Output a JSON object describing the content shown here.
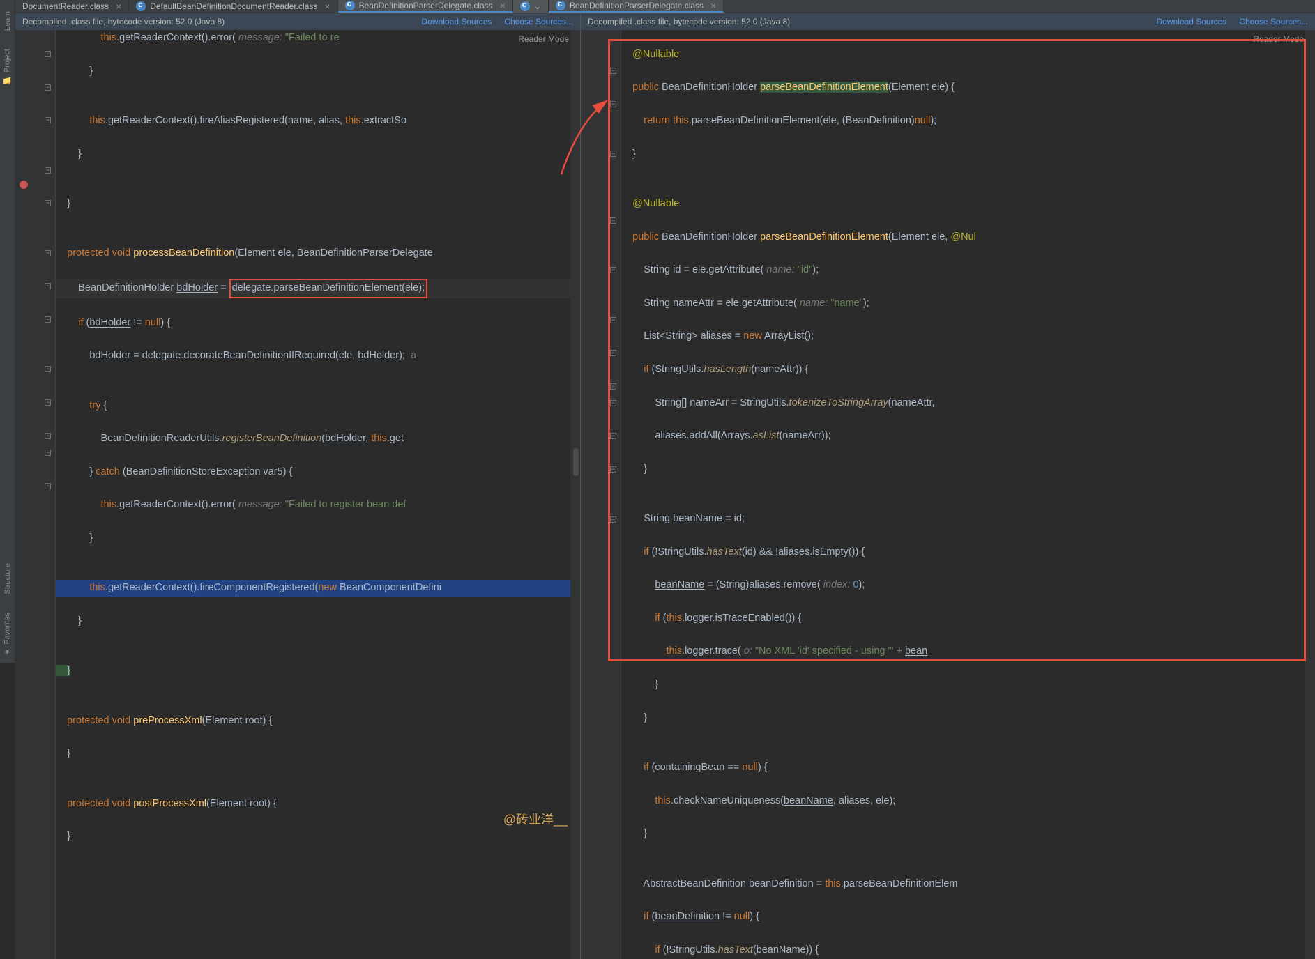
{
  "sidebar": {
    "learn": "Learn",
    "project": "Project",
    "structure": "Structure",
    "favorites": "Favorites"
  },
  "tabs_left": [
    {
      "label": "DocumentReader.class",
      "active": false,
      "partial": true
    },
    {
      "label": "DefaultBeanDefinitionDocumentReader.class",
      "active": false
    },
    {
      "label": "BeanDefinitionParserDelegate.class",
      "active": true
    }
  ],
  "tabs_right": [
    {
      "label": "BeanDefinitionParserDelegate.class",
      "active": true
    }
  ],
  "info_left": {
    "text": "Decompiled .class file, bytecode version: 52.0 (Java 8)",
    "download": "Download Sources",
    "choose": "Choose Sources..."
  },
  "info_right": {
    "text": "Decompiled .class file, bytecode version: 52.0 (Java 8)",
    "download": "Download Sources",
    "choose": "Choose Sources..."
  },
  "reader_mode": "Reader Mode",
  "watermark": "@砖业洋__",
  "left_code": {
    "l1a": "                ",
    "l1b": "this",
    "l1c": ".getReaderContext().error( ",
    "l1p": "message:",
    "l1d": " \"Failed to re",
    "l2": "            }",
    "l3": "",
    "l4a": "            ",
    "l4b": "this",
    "l4c": ".getReaderContext().fireAliasRegistered(name, alias, ",
    "l4d": "this",
    "l4e": ".extractSo",
    "l5": "        }",
    "l6": "",
    "l7": "    }",
    "l8": "",
    "l9a": "    ",
    "l9k": "protected void ",
    "l9m": "processBeanDefinition",
    "l9c": "(Element ele, BeanDefinitionParserDelegate",
    "l10a": "        BeanDefinitionHolder ",
    "l10u": "bdHolder",
    "l10b": " = ",
    "l10box": "delegate.parseBeanDefinitionElement(ele);",
    "l11a": "        ",
    "l11k": "if ",
    "l11b": "(",
    "l11u": "bdHolder",
    "l11c": " != ",
    "l11n": "null",
    "l11d": ") {",
    "l12a": "            ",
    "l12u": "bdHolder",
    "l12b": " = delegate.decorateBeanDefinitionIfRequired(ele, ",
    "l12u2": "bdHolder",
    "l12c": ");  ",
    "l12cm": "a",
    "l13": "",
    "l14a": "            ",
    "l14k": "try ",
    "l14b": "{",
    "l15a": "                BeanDefinitionReaderUtils.",
    "l15m": "registerBeanDefinition",
    "l15b": "(",
    "l15u": "bdHolder",
    "l15c": ", ",
    "l15d": "this",
    "l15e": ".get",
    "l16a": "            } ",
    "l16k": "catch ",
    "l16b": "(BeanDefinitionStoreException var5) {",
    "l17a": "                ",
    "l17b": "this",
    "l17c": ".getReaderContext().error( ",
    "l17p": "message:",
    "l17d": " ",
    "l17s": "\"Failed to register bean def",
    "l18": "            }",
    "l19": "",
    "l20a": "            ",
    "l20b": "this",
    "l20c": ".getReaderContext().fireComponentRegistered(",
    "l20k": "new ",
    "l20d": "BeanComponentDefini",
    "l21": "        }",
    "l22": "",
    "l23": "    }",
    "l24": "",
    "l25a": "    ",
    "l25k": "protected void ",
    "l25m": "preProcessXml",
    "l25c": "(Element root) {",
    "l26": "    }",
    "l27": "",
    "l28a": "    ",
    "l28k": "protected void ",
    "l28m": "postProcessXml",
    "l28c": "(Element root) {",
    "l29": "    }"
  },
  "right_code": {
    "r1": "    @Nullable",
    "r2a": "    ",
    "r2k": "public ",
    "r2b": "BeanDefinitionHolder ",
    "r2m": "parseBeanDefinitionElement",
    "r2c": "(Element ele) {",
    "r3a": "        ",
    "r3k": "return this",
    "r3b": ".parseBeanDefinitionElement(ele, (BeanDefinition)",
    "r3n": "null",
    "r3c": ");",
    "r4": "    }",
    "r5": "",
    "r6": "    @Nullable",
    "r7a": "    ",
    "r7k": "public ",
    "r7b": "BeanDefinitionHolder ",
    "r7m": "parseBeanDefinitionElement",
    "r7c": "(Element ele, ",
    "r7a2": "@Nul",
    "r8a": "        String id = ele.getAttribute( ",
    "r8p": "name:",
    "r8b": " ",
    "r8s": "\"id\"",
    "r8c": ");",
    "r9a": "        String nameAttr = ele.getAttribute( ",
    "r9p": "name:",
    "r9b": " ",
    "r9s": "\"name\"",
    "r9c": ");",
    "r10a": "        List<String> aliases = ",
    "r10k": "new ",
    "r10b": "ArrayList();",
    "r11a": "        ",
    "r11k": "if ",
    "r11b": "(StringUtils.",
    "r11m": "hasLength",
    "r11c": "(nameAttr)) {",
    "r12a": "            String[] nameArr = StringUtils.",
    "r12m": "tokenizeToStringArray",
    "r12b": "(nameAttr, ",
    "r13a": "            aliases.addAll(Arrays.",
    "r13m": "asList",
    "r13b": "(nameArr));",
    "r14": "        }",
    "r15": "",
    "r16a": "        String ",
    "r16u": "beanName",
    "r16b": " = id;",
    "r17a": "        ",
    "r17k": "if ",
    "r17b": "(!StringUtils.",
    "r17m": "hasText",
    "r17c": "(id) && !aliases.isEmpty()) {",
    "r18a": "            ",
    "r18u": "beanName",
    "r18b": " = (String)aliases.remove( ",
    "r18p": "index:",
    "r18c": " ",
    "r18n": "0",
    "r18d": ");",
    "r19a": "            ",
    "r19k": "if ",
    "r19b": "(",
    "r19c": "this",
    "r19d": ".logger.isTraceEnabled()) {",
    "r20a": "                ",
    "r20b": "this",
    "r20c": ".logger.trace( ",
    "r20p": "o:",
    "r20d": " ",
    "r20s": "\"No XML 'id' specified - using '\"",
    "r20e": " + ",
    "r20u": "bean",
    "r21": "            }",
    "r22": "        }",
    "r23": "",
    "r24a": "        ",
    "r24k": "if ",
    "r24b": "(containingBean == ",
    "r24n": "null",
    "r24c": ") {",
    "r25a": "            ",
    "r25b": "this",
    "r25c": ".checkNameUniqueness(",
    "r25u": "beanName",
    "r25d": ", aliases, ele);",
    "r26": "        }",
    "r27": "",
    "r28a": "        AbstractBeanDefinition beanDefinition = ",
    "r28b": "this",
    "r28c": ".parseBeanDefinitionElem",
    "r29a": "        ",
    "r29k": "if ",
    "r29b": "(",
    "r29u": "beanDefinition",
    "r29c": " != ",
    "r29n": "null",
    "r29d": ") {",
    "r30a": "            ",
    "r30k": "if ",
    "r30b": "(!StringUtils.",
    "r30m": "hasText",
    "r30c": "(beanName)) {"
  }
}
